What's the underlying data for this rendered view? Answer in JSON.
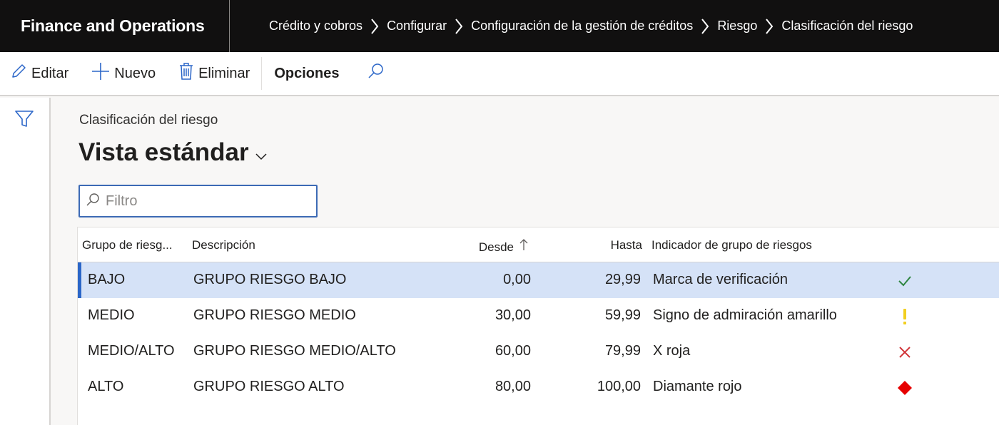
{
  "app": {
    "title": "Finance and Operations"
  },
  "breadcrumb": [
    "Crédito y cobros",
    "Configurar",
    "Configuración de la gestión de créditos",
    "Riesgo",
    "Clasificación del riesgo"
  ],
  "actions": {
    "edit_label": "Editar",
    "new_label": "Nuevo",
    "delete_label": "Eliminar",
    "options_label": "Opciones"
  },
  "page": {
    "caption": "Clasificación del riesgo",
    "view_name": "Vista estándar",
    "filter_placeholder": "Filtro",
    "filter_value": ""
  },
  "grid": {
    "columns": {
      "group": "Grupo de riesg...",
      "description": "Descripción",
      "from": "Desde",
      "to": "Hasta",
      "indicator": "Indicador de grupo de riesgos"
    },
    "sort": {
      "column": "from",
      "direction": "ascending"
    },
    "rows": [
      {
        "group": "BAJO",
        "description": "GRUPO RIESGO BAJO",
        "from": "0,00",
        "to": "29,99",
        "indicator": "Marca de verificación",
        "icon": "checkmark-icon",
        "icon_color": "#2e8540",
        "selected": true
      },
      {
        "group": "MEDIO",
        "description": "GRUPO RIESGO MEDIO",
        "from": "30,00",
        "to": "59,99",
        "indicator": "Signo de admiración amarillo",
        "icon": "exclamation-icon",
        "icon_color": "#f2cf1f",
        "selected": false
      },
      {
        "group": "MEDIO/ALTO",
        "description": "GRUPO RIESGO MEDIO/ALTO",
        "from": "60,00",
        "to": "79,99",
        "indicator": "X roja",
        "icon": "red-x-icon",
        "icon_color": "#d13438",
        "selected": false
      },
      {
        "group": "ALTO",
        "description": "GRUPO RIESGO ALTO",
        "from": "80,00",
        "to": "100,00",
        "indicator": "Diamante rojo",
        "icon": "red-diamond-icon",
        "icon_color": "#e60000",
        "selected": false
      }
    ]
  },
  "colors": {
    "accent": "#2b66c8",
    "selected_row": "#d5e2f7",
    "topbar": "#111010"
  }
}
